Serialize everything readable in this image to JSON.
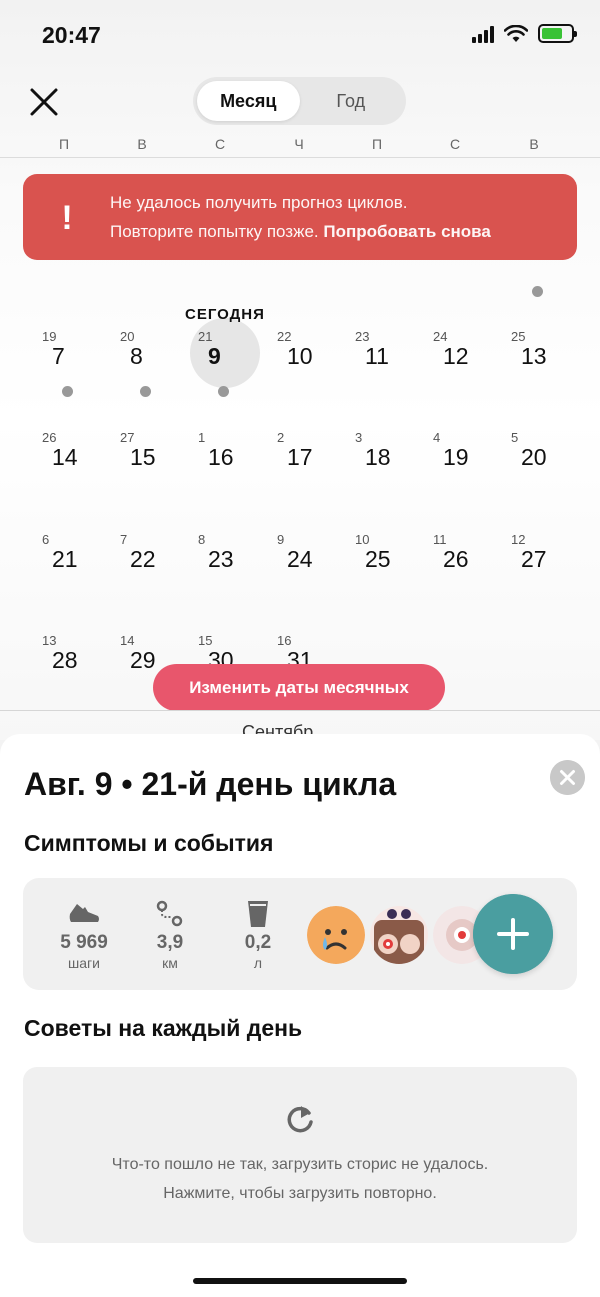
{
  "status_bar": {
    "time": "20:47"
  },
  "header": {
    "tabs": [
      {
        "label": "Месяц",
        "active": true
      },
      {
        "label": "Год",
        "active": false
      }
    ],
    "weekdays": [
      "П",
      "В",
      "С",
      "Ч",
      "П",
      "С",
      "В"
    ]
  },
  "banner": {
    "line1": "Не удалось получить прогноз циклов.",
    "line2_text": "Повторите попытку позже.",
    "retry_label": "Попробовать снова",
    "icon": "!"
  },
  "calendar": {
    "today_label": "СЕГОДНЯ",
    "weeks": [
      [
        {
          "cycle_day": "19",
          "date": "7",
          "dot": true
        },
        {
          "cycle_day": "20",
          "date": "8",
          "dot": true
        },
        {
          "cycle_day": "21",
          "date": "9",
          "dot": true,
          "today": true
        },
        {
          "cycle_day": "22",
          "date": "10"
        },
        {
          "cycle_day": "23",
          "date": "11"
        },
        {
          "cycle_day": "24",
          "date": "12"
        },
        {
          "cycle_day": "25",
          "date": "13"
        }
      ],
      [
        {
          "cycle_day": "26",
          "date": "14"
        },
        {
          "cycle_day": "27",
          "date": "15"
        },
        {
          "cycle_day": "1",
          "date": "16"
        },
        {
          "cycle_day": "2",
          "date": "17"
        },
        {
          "cycle_day": "3",
          "date": "18"
        },
        {
          "cycle_day": "4",
          "date": "19"
        },
        {
          "cycle_day": "5",
          "date": "20"
        }
      ],
      [
        {
          "cycle_day": "6",
          "date": "21"
        },
        {
          "cycle_day": "7",
          "date": "22"
        },
        {
          "cycle_day": "8",
          "date": "23"
        },
        {
          "cycle_day": "9",
          "date": "24"
        },
        {
          "cycle_day": "10",
          "date": "25"
        },
        {
          "cycle_day": "11",
          "date": "26"
        },
        {
          "cycle_day": "12",
          "date": "27"
        }
      ],
      [
        {
          "cycle_day": "13",
          "date": "28"
        },
        {
          "cycle_day": "14",
          "date": "29"
        },
        {
          "cycle_day": "15",
          "date": "30"
        },
        {
          "cycle_day": "16",
          "date": "31"
        }
      ]
    ],
    "edit_period_label": "Изменить даты месячных",
    "next_month_partial": "Сентябр"
  },
  "sheet": {
    "title": "Авг. 9 • 21-й день цикла",
    "symptoms_title": "Симптомы и события",
    "metrics": [
      {
        "value": "5 969",
        "unit": "шаги",
        "icon": "shoe-icon"
      },
      {
        "value": "3,9",
        "unit": "км",
        "icon": "route-icon"
      },
      {
        "value": "0,2",
        "unit": "л",
        "icon": "water-glass-icon"
      }
    ],
    "tips_title": "Советы на каждый день",
    "tips_error_line1": "Что-то пошло не так, загрузить сторис не удалось.",
    "tips_error_line2": "Нажмите, чтобы загрузить повторно."
  },
  "colors": {
    "banner": "#d9534f",
    "edit_button": "#e8566c",
    "add_button": "#4a9ea0",
    "today_circle": "#e6e6e6"
  }
}
